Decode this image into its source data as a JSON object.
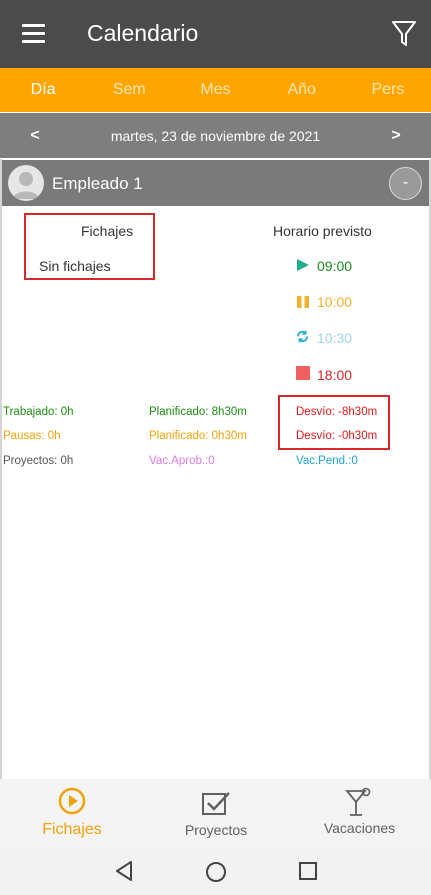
{
  "app_bar": {
    "title": "Calendario",
    "menu_icon": "menu-icon",
    "filter_icon": "filter-icon"
  },
  "tabs": [
    {
      "label": "Día",
      "active": true
    },
    {
      "label": "Sem",
      "active": false
    },
    {
      "label": "Mes",
      "active": false
    },
    {
      "label": "Año",
      "active": false
    },
    {
      "label": "Pers",
      "active": false
    }
  ],
  "date_bar": {
    "prev": "<",
    "date": "martes, 23 de noviembre de 2021",
    "next": ">"
  },
  "employee": {
    "name": "Empleado 1",
    "collapse": "-"
  },
  "fichajes": {
    "title": "Fichajes",
    "empty": "Sin fichajes"
  },
  "horario": {
    "title": "Horario previsto",
    "entries": [
      {
        "icon": "play-icon",
        "time": "09:00",
        "color": "#1a8a1a"
      },
      {
        "icon": "pause-icon",
        "time": "10:00",
        "color": "#f3b02a"
      },
      {
        "icon": "sync-icon",
        "time": "10:30",
        "color": "#9fd2ea"
      },
      {
        "icon": "stop-icon",
        "time": "18:00",
        "color": "#d42525"
      }
    ]
  },
  "stats": {
    "trabajado": "Trabajado: 0h",
    "planificado_trabajo": "Planificado: 8h30m",
    "desvio_trabajo": "Desvío: -8h30m",
    "pausas": "Pausas: 0h",
    "planificado_pausas": "Planificado: 0h30m",
    "desvio_pausas": "Desvío: -0h30m",
    "proyectos": "Proyectos: 0h",
    "vac_aprob": "Vac.Aprob.:0",
    "vac_pend": "Vac.Pend.:0"
  },
  "bottom_nav": [
    {
      "label": "Fichajes",
      "icon": "play-circle-icon",
      "active": true
    },
    {
      "label": "Proyectos",
      "icon": "checkbox-icon",
      "active": false
    },
    {
      "label": "Vacaciones",
      "icon": "cocktail-icon",
      "active": false
    }
  ],
  "system_nav": {
    "back": "back-icon",
    "home": "home-icon",
    "recents": "recents-icon"
  }
}
